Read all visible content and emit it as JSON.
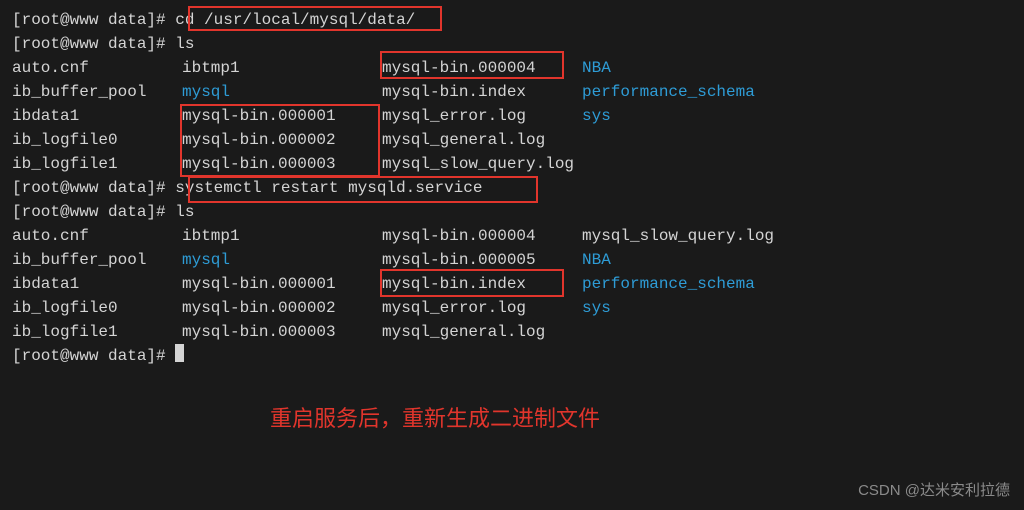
{
  "prompt": "[root@www data]# ",
  "cmd1": "cd /usr/local/mysql/data/",
  "cmd2": "ls",
  "cmd3": "systemctl restart mysqld.service",
  "cmd4": "ls",
  "ls1": {
    "r1c1": "auto.cnf",
    "r1c2": "ibtmp1",
    "r1c3": "mysql-bin.000004",
    "r1c4": "NBA",
    "r2c1": "ib_buffer_pool",
    "r2c2": "mysql",
    "r2c3": "mysql-bin.index",
    "r2c4": "performance_schema",
    "r3c1": "ibdata1",
    "r3c2": "mysql-bin.000001",
    "r3c3": "mysql_error.log",
    "r3c4": "sys",
    "r4c1": "ib_logfile0",
    "r4c2": "mysql-bin.000002",
    "r4c3": "mysql_general.log",
    "r5c1": "ib_logfile1",
    "r5c2": "mysql-bin.000003",
    "r5c3": "mysql_slow_query.log"
  },
  "ls2": {
    "r1c1": "auto.cnf",
    "r1c2": "ibtmp1",
    "r1c3": "mysql-bin.000004",
    "r1c4": "mysql_slow_query.log",
    "r2c1": "ib_buffer_pool",
    "r2c2": "mysql",
    "r2c3": "mysql-bin.000005",
    "r2c4": "NBA",
    "r3c1": "ibdata1",
    "r3c2": "mysql-bin.000001",
    "r3c3": "mysql-bin.index",
    "r3c4": "performance_schema",
    "r4c1": "ib_logfile0",
    "r4c2": "mysql-bin.000002",
    "r4c3": "mysql_error.log",
    "r4c4": "sys",
    "r5c1": "ib_logfile1",
    "r5c2": "mysql-bin.000003",
    "r5c3": "mysql_general.log"
  },
  "annotation": "重启服务后，重新生成二进制文件",
  "watermark": "CSDN @达米安利拉德"
}
